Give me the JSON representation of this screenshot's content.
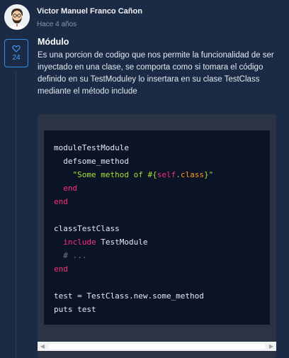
{
  "comment": {
    "author": "Victor Manuel Franco Cañon",
    "timestamp": "Hace 4 años",
    "likes": "24",
    "title": "Módulo",
    "body": "Es una porcion de codigo que nos permite la funcionalidad de ser inyectado en una clase, se comporta como si tomara el código definido en su TestModuley lo insertara en su clase TestClass mediante el método include"
  },
  "code": {
    "lines": [
      "moduleTestModule",
      "  defsome_method",
      "    \"Some method of #{self.class}\"",
      "  end",
      "end",
      "",
      "classTestClass",
      "  include TestModule",
      "  # ...",
      "end",
      "",
      "test = TestClass.new.some_method",
      "puts test"
    ]
  },
  "icons": {
    "like": "heart-icon",
    "scroll_left": "arrow-left-icon",
    "scroll_right": "arrow-right-icon"
  },
  "colors": {
    "background": "#1c2b45",
    "accent": "#2f90e8",
    "keyword": "#ff2e78",
    "string": "#a6e22e",
    "interpolation": "#fd971f",
    "code_background": "#0b1327"
  }
}
